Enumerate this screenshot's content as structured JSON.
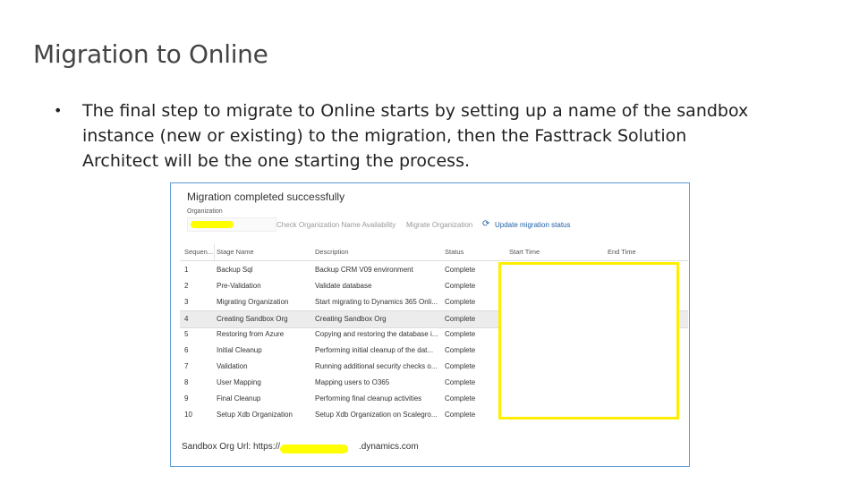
{
  "slide": {
    "title": "Migration to Online",
    "bullet": "•",
    "text": "The final step to migrate to Online starts by setting up a name of the sandbox instance (new or existing) to the migration, then the Fasttrack Solution Architect will be the one starting the process."
  },
  "screenshot": {
    "title": "Migration completed successfully",
    "org_label": "Organization",
    "org_value": "",
    "toolbar": {
      "check": "Check Organization Name Availability",
      "migrate": "Migrate Organization",
      "update": "Update migration status",
      "update_icon": "refresh-icon"
    },
    "columns": [
      "Sequen...",
      "Stage Name",
      "Description",
      "Status",
      "Start Time",
      "End Time"
    ],
    "rows": [
      {
        "seq": "1",
        "stage": "Backup Sql",
        "desc": "Backup CRM V09 environment",
        "status": "Complete"
      },
      {
        "seq": "2",
        "stage": "Pre-Validation",
        "desc": "Validate database",
        "status": "Complete"
      },
      {
        "seq": "3",
        "stage": "Migrating Organization",
        "desc": "Start migrating to Dynamics 365 Onli...",
        "status": "Complete"
      },
      {
        "seq": "4",
        "stage": "Creating Sandbox Org",
        "desc": "Creating Sandbox Org",
        "status": "Complete"
      },
      {
        "seq": "5",
        "stage": "Restoring from Azure",
        "desc": "Copying and restoring the database i...",
        "status": "Complete"
      },
      {
        "seq": "6",
        "stage": "Initial Cleanup",
        "desc": "Performing initial cleanup of the dat...",
        "status": "Complete"
      },
      {
        "seq": "7",
        "stage": "Validation",
        "desc": "Running additional security checks o...",
        "status": "Complete"
      },
      {
        "seq": "8",
        "stage": "User Mapping",
        "desc": "Mapping users to O365",
        "status": "Complete"
      },
      {
        "seq": "9",
        "stage": "Final Cleanup",
        "desc": "Performing final cleanup activities",
        "status": "Complete"
      },
      {
        "seq": "10",
        "stage": "Setup Xdb Organization",
        "desc": "Setup Xdb Organization on Scalegro...",
        "status": "Complete"
      }
    ],
    "url_prefix": "Sandbox Org Url: https://",
    "url_suffix": ".dynamics.com",
    "colors": {
      "border": "#5b9bd5",
      "highlight": "#ffee00",
      "redaction": "#ffff00",
      "link": "#1f5fa6"
    }
  }
}
